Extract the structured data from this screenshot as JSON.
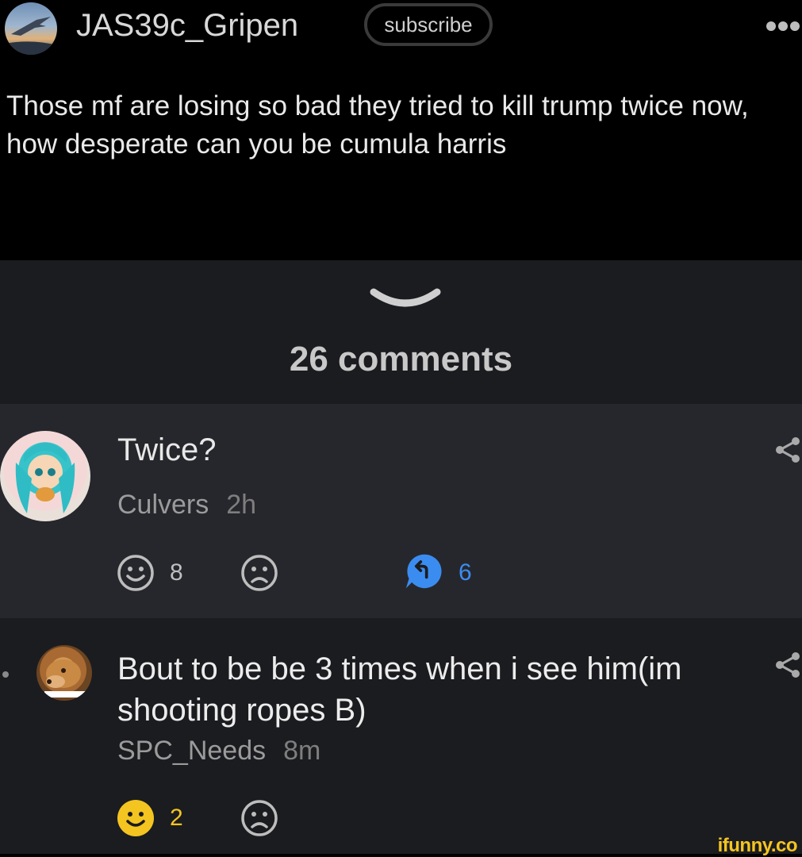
{
  "post": {
    "username": "JAS39c_Gripen",
    "subscribe_label": "subscribe",
    "text": "Those mf are losing so bad they tried to kill trump twice now, how desperate can you be cumula harris"
  },
  "comments_header": {
    "count_label": "26 comments"
  },
  "comments": [
    {
      "text": "Twice?",
      "author": "Culvers",
      "time": "2h",
      "likes": "8",
      "replies": "6"
    },
    {
      "text": "Bout to be be 3 times when i see him(im shooting ropes B)",
      "author": "SPC_Needs",
      "time": "8m",
      "likes": "2"
    }
  ],
  "watermark": "ifunny.co",
  "colors": {
    "background": "#000000",
    "card": "#26272c",
    "card_alt": "#1b1c20",
    "reply_blue": "#3b8cf0",
    "smile_yellow": "#f4c520"
  },
  "icons": [
    "more-icon",
    "chevron-down-icon",
    "share-icon",
    "smile-icon",
    "frown-icon",
    "reply-icon"
  ]
}
